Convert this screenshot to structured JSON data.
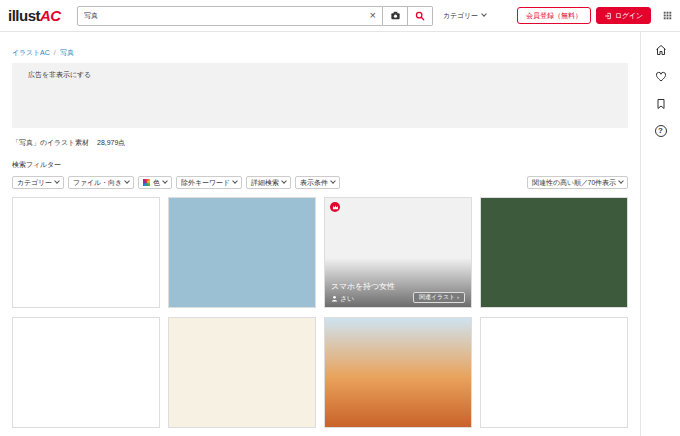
{
  "header": {
    "logo": [
      "illust",
      "AC"
    ],
    "search": {
      "value": "写真",
      "clear": "×"
    },
    "category": "カテゴリー",
    "register": "会員登録（無料）",
    "login": "ログイン"
  },
  "breadcrumb": [
    {
      "label": "イラストAC"
    },
    {
      "label": "写真"
    }
  ],
  "breadcrumb_separator": "/",
  "ad": {
    "label": "広告を非表示にする"
  },
  "result": {
    "title": "「写真」のイラスト素材",
    "count": "28,979点"
  },
  "filter": {
    "title": "検索フィルター",
    "buttons": [
      {
        "label": "カテゴリー",
        "kind": "plain"
      },
      {
        "label": "ファイル・向き",
        "kind": "plain"
      },
      {
        "label": "色",
        "kind": "color"
      },
      {
        "label": "除外キーワード",
        "kind": "plain"
      },
      {
        "label": "詳細検索",
        "kind": "plain"
      },
      {
        "label": "表示条件",
        "kind": "plain"
      }
    ],
    "sort": "関連性の高い順／70件表示"
  },
  "items": [
    {
      "hovered": false
    },
    {
      "hovered": false
    },
    {
      "hovered": true,
      "title": "スマホを持つ女性",
      "author": "さい",
      "related": "関連イラスト ›"
    },
    {
      "hovered": false
    },
    {
      "hovered": false
    },
    {
      "hovered": false
    },
    {
      "hovered": false
    },
    {
      "hovered": false
    }
  ],
  "sidebar": {
    "help": "?"
  }
}
